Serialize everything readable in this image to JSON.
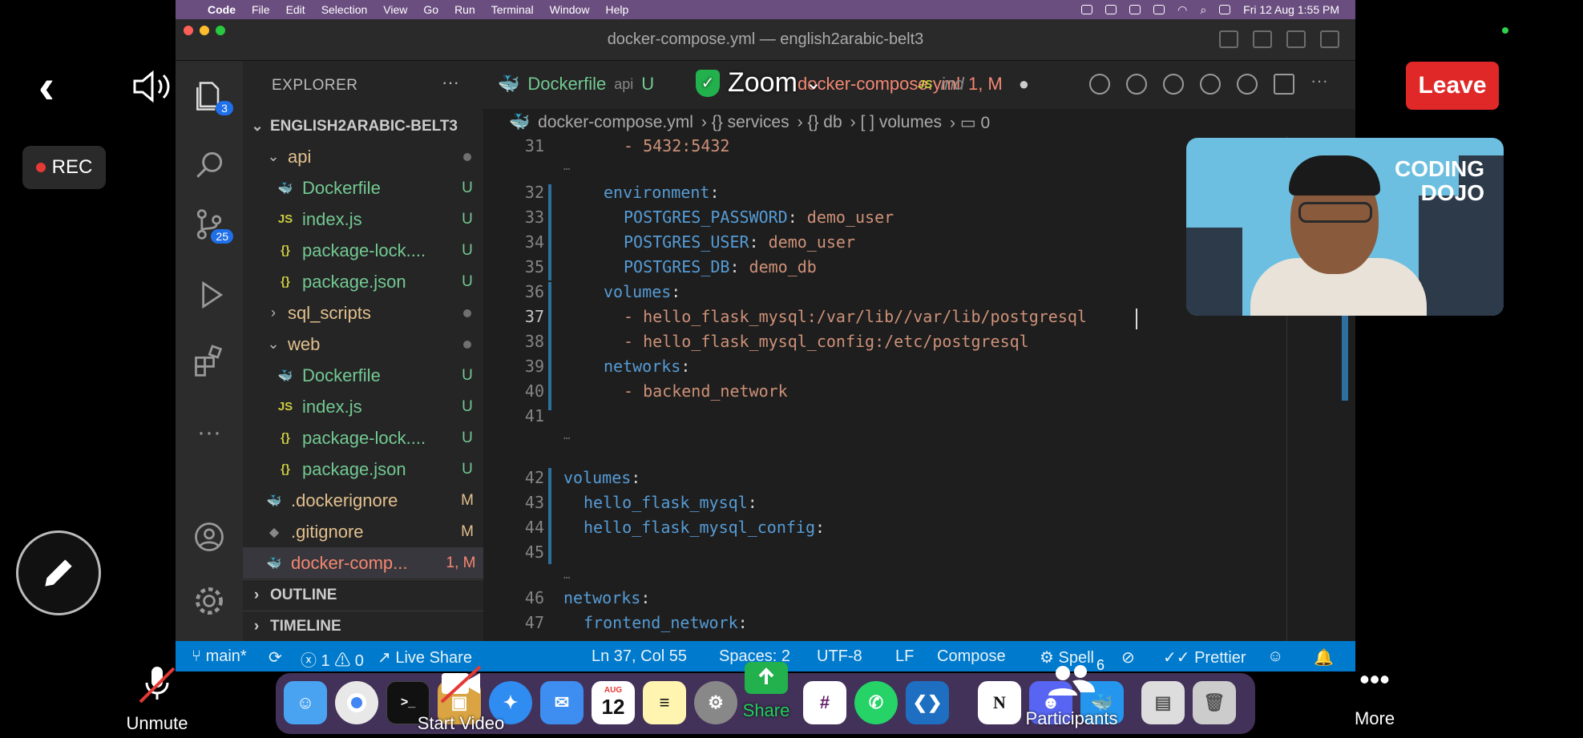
{
  "menubar": {
    "app": "Code",
    "items": [
      "File",
      "Edit",
      "Selection",
      "View",
      "Go",
      "Run",
      "Terminal",
      "Window",
      "Help"
    ],
    "clock": "Fri 12 Aug  1:55 PM"
  },
  "window": {
    "title": "docker-compose.yml — english2arabic-belt3"
  },
  "activity": {
    "explorer_badge": "3",
    "scm_badge": "25"
  },
  "explorer": {
    "title": "EXPLORER",
    "more": "···",
    "root": "ENGLISH2ARABIC-BELT3",
    "rows": [
      {
        "name": "api",
        "icon": "",
        "status": ""
      },
      {
        "name": "Dockerfile",
        "icon": "🐳",
        "status": "U"
      },
      {
        "name": "index.js",
        "icon": "JS",
        "status": "U"
      },
      {
        "name": "package-lock....",
        "icon": "{}",
        "status": "U"
      },
      {
        "name": "package.json",
        "icon": "{}",
        "status": "U"
      },
      {
        "name": "sql_scripts",
        "icon": "",
        "status": ""
      },
      {
        "name": "web",
        "icon": "",
        "status": ""
      },
      {
        "name": "Dockerfile",
        "icon": "🐳",
        "status": "U"
      },
      {
        "name": "index.js",
        "icon": "JS",
        "status": "U"
      },
      {
        "name": "package-lock....",
        "icon": "{}",
        "status": "U"
      },
      {
        "name": "package.json",
        "icon": "{}",
        "status": "U"
      },
      {
        "name": ".dockerignore",
        "icon": "",
        "status": "M"
      },
      {
        "name": ".gitignore",
        "icon": "",
        "status": "M"
      },
      {
        "name": "docker-comp...",
        "icon": "",
        "status": "1, M"
      }
    ],
    "outline": "OUTLINE",
    "timeline": "TIMELINE"
  },
  "tabs": [
    {
      "name": "Dockerfile",
      "sub": "api",
      "status": "U"
    },
    {
      "name": "docker-compose.yml",
      "sub": "1, M",
      "status": ""
    },
    {
      "name": "JS",
      "sub": "ind",
      "status": ""
    }
  ],
  "breadcrumb": [
    "docker-compose.yml",
    "› {} services",
    "› {} db",
    "› [ ] volumes",
    "› ▭ 0"
  ],
  "code_lines": [
    {
      "n": "31",
      "k": "",
      "v": "- 5432:5432",
      "indent": 3
    },
    {
      "n": "32",
      "k": "environment",
      "v": "",
      "indent": 2
    },
    {
      "n": "33",
      "k": "POSTGRES_PASSWORD",
      "v": "demo_user",
      "indent": 3
    },
    {
      "n": "34",
      "k": "POSTGRES_USER",
      "v": "demo_user",
      "indent": 3
    },
    {
      "n": "35",
      "k": "POSTGRES_DB",
      "v": "demo_db",
      "indent": 3
    },
    {
      "n": "36",
      "k": "volumes",
      "v": "",
      "indent": 2
    },
    {
      "n": "37",
      "k": "",
      "v": "- hello_flask_mysql:/var/lib//var/lib/postgresql",
      "indent": 3
    },
    {
      "n": "38",
      "k": "",
      "v": "- hello_flask_mysql_config:/etc/postgresql",
      "indent": 3
    },
    {
      "n": "39",
      "k": "networks",
      "v": "",
      "indent": 2
    },
    {
      "n": "40",
      "k": "",
      "v": "- backend_network",
      "indent": 3
    },
    {
      "n": "41",
      "k": "",
      "v": "",
      "indent": 0
    },
    {
      "n": "42",
      "k": "volumes",
      "v": "",
      "indent": 0
    },
    {
      "n": "43",
      "k": "hello_flask_mysql",
      "v": "",
      "indent": 1
    },
    {
      "n": "44",
      "k": "hello_flask_mysql_config",
      "v": "",
      "indent": 1
    },
    {
      "n": "45",
      "k": "",
      "v": "",
      "indent": 0
    },
    {
      "n": "46",
      "k": "networks",
      "v": "",
      "indent": 0
    },
    {
      "n": "47",
      "k": "frontend_network",
      "v": "",
      "indent": 1
    }
  ],
  "statusbar": {
    "branch": "main*",
    "problems": "ⓧ 1 ⚠ 0",
    "liveshare": "Live Share",
    "position": "Ln 37, Col 55",
    "spaces": "Spaces: 2",
    "encoding": "UTF-8",
    "eol": "LF",
    "language": "Compose",
    "spell": "Spell",
    "prettier": "Prettier"
  },
  "dock": {
    "calendar_month": "AUG",
    "calendar_day": "12",
    "calendar_badge": "12"
  },
  "zoom": {
    "title": "Zoom",
    "leave": "Leave",
    "rec": "REC",
    "unmute": "Unmute",
    "start_video": "Start Video",
    "share": "Share",
    "participants": "Participants",
    "participants_count": "6",
    "more": "More"
  },
  "video": {
    "logo_line1": "CODING",
    "logo_line2": "DOJO"
  },
  "colors": {
    "leave": "#e02828",
    "statusbar": "#007acc",
    "share": "#22b14c",
    "keyword": "#569cd6",
    "string": "#ce9178"
  }
}
